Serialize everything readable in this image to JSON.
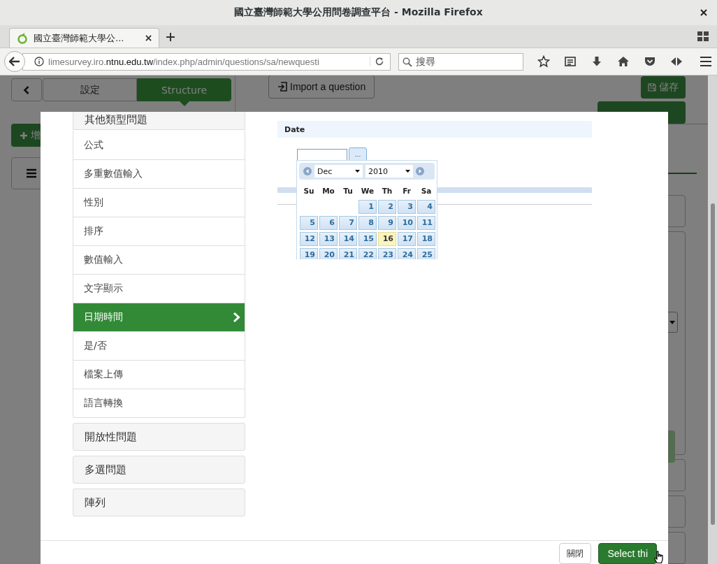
{
  "window": {
    "title": "國立臺灣師範大學公用問卷調查平台 - Mozilla Firefox"
  },
  "tabs": [
    {
      "label": "國立臺灣師範大學公...",
      "selected": true
    }
  ],
  "address_bar": {
    "host_prefix": "limesurvey.iro.",
    "host_domain": "ntnu.edu.tw",
    "path": "/index.php/admin/questions/sa/newquesti"
  },
  "search": {
    "placeholder": "搜尋"
  },
  "page": {
    "side_tabs": [
      {
        "label": "設定",
        "selected": false
      },
      {
        "label": "Structure",
        "selected": true
      }
    ],
    "add_button": "增",
    "import_button": "Import a question",
    "save_button": "儲存"
  },
  "modal": {
    "groups": [
      {
        "label": "其他類型問題",
        "expanded": true,
        "items": [
          {
            "label": "公式",
            "selected": false
          },
          {
            "label": "多重數值輸入",
            "selected": false
          },
          {
            "label": "性別",
            "selected": false
          },
          {
            "label": "排序",
            "selected": false
          },
          {
            "label": "數值輸入",
            "selected": false
          },
          {
            "label": "文字顯示",
            "selected": false
          },
          {
            "label": "日期時間",
            "selected": true
          },
          {
            "label": "是/否",
            "selected": false
          },
          {
            "label": "檔案上傳",
            "selected": false
          },
          {
            "label": "語言轉換",
            "selected": false
          }
        ]
      },
      {
        "label": "開放性問題",
        "expanded": false
      },
      {
        "label": "多選問題",
        "expanded": false
      },
      {
        "label": "陣列",
        "expanded": false
      }
    ],
    "preview": {
      "question_title": "Date",
      "picker_button": "...",
      "datepicker": {
        "month": "Dec",
        "year": "2010",
        "weekdays": [
          "Su",
          "Mo",
          "Tu",
          "We",
          "Th",
          "Fr",
          "Sa"
        ],
        "weeks": [
          [
            {
              "kind": "empty"
            },
            {
              "kind": "empty"
            },
            {
              "kind": "empty"
            },
            {
              "kind": "day",
              "label": "1",
              "today": false
            },
            {
              "kind": "day",
              "label": "2",
              "today": false
            },
            {
              "kind": "day",
              "label": "3",
              "today": false
            },
            {
              "kind": "day",
              "label": "4",
              "today": false
            }
          ],
          [
            {
              "kind": "day",
              "label": "5",
              "today": false
            },
            {
              "kind": "day",
              "label": "6",
              "today": false
            },
            {
              "kind": "day",
              "label": "7",
              "today": false
            },
            {
              "kind": "day",
              "label": "8",
              "today": false
            },
            {
              "kind": "day",
              "label": "9",
              "today": false
            },
            {
              "kind": "day",
              "label": "10",
              "today": false
            },
            {
              "kind": "day",
              "label": "11",
              "today": false
            }
          ],
          [
            {
              "kind": "day",
              "label": "12",
              "today": false
            },
            {
              "kind": "day",
              "label": "13",
              "today": false
            },
            {
              "kind": "day",
              "label": "14",
              "today": false
            },
            {
              "kind": "day",
              "label": "15",
              "today": false
            },
            {
              "kind": "day",
              "label": "16",
              "today": true
            },
            {
              "kind": "day",
              "label": "17",
              "today": false
            },
            {
              "kind": "day",
              "label": "18",
              "today": false
            }
          ],
          [
            {
              "kind": "day",
              "label": "19",
              "today": false
            },
            {
              "kind": "day",
              "label": "20",
              "today": false
            },
            {
              "kind": "day",
              "label": "21",
              "today": false
            },
            {
              "kind": "day",
              "label": "22",
              "today": false
            },
            {
              "kind": "day",
              "label": "23",
              "today": false
            },
            {
              "kind": "day",
              "label": "24",
              "today": false
            },
            {
              "kind": "day",
              "label": "25",
              "today": false
            }
          ]
        ]
      }
    },
    "buttons": [
      {
        "label": "關閉",
        "kind": "default"
      },
      {
        "label": "Select thi",
        "kind": "primary"
      }
    ]
  }
}
